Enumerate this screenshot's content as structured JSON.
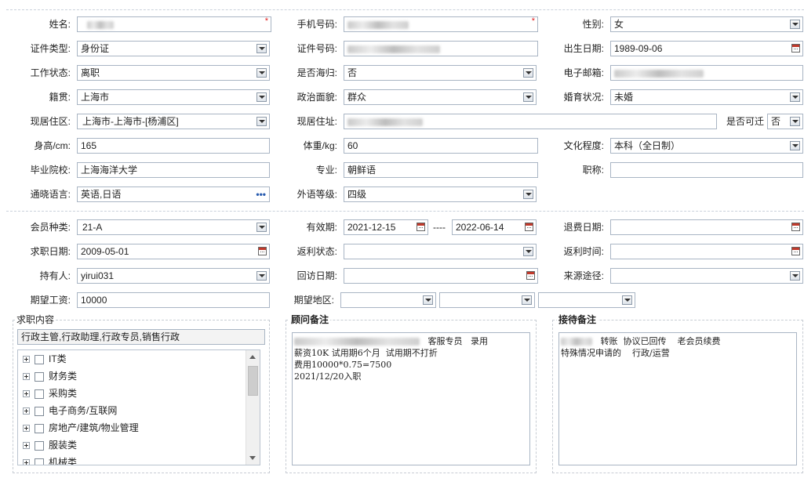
{
  "basic": {
    "name_label": "姓名:",
    "phone_label": "手机号码:",
    "required_mark": "*",
    "gender_label": "性别:",
    "gender_value": "女",
    "idtype_label": "证件类型:",
    "idtype_value": "身份证",
    "idno_label": "证件号码:",
    "birth_label": "出生日期:",
    "birth_value": "1989-09-06",
    "workstatus_label": "工作状态:",
    "workstatus_value": "离职",
    "returnee_label": "是否海归:",
    "returnee_value": "否",
    "email_label": "电子邮箱:",
    "native_label": "籍贯:",
    "native_value": "上海市",
    "political_label": "政治面貌:",
    "political_value": "群众",
    "marital_label": "婚育状况:",
    "marital_value": "未婚",
    "residence_label": "现居住区:",
    "residence_value": "上海市-上海市-[杨浦区]",
    "address_label": "现居住址:",
    "relocate_label": "是否可迁",
    "relocate_value": "否",
    "height_label": "身高/cm:",
    "height_value": "165",
    "weight_label": "体重/kg:",
    "weight_value": "60",
    "education_label": "文化程度:",
    "education_value": "本科（全日制）",
    "school_label": "毕业院校:",
    "school_value": "上海海洋大学",
    "major_label": "专业:",
    "major_value": "朝鲜语",
    "title_label": "职称:",
    "languages_label": "通晓语言:",
    "languages_value": "英语,日语",
    "languages_more": "•••",
    "foreignlevel_label": "外语等级:",
    "foreignlevel_value": "四级"
  },
  "membership": {
    "type_label": "会员种类:",
    "type_value": "21-A",
    "validity_label": "有效期:",
    "validity_start": "2021-12-15",
    "validity_sep": "----",
    "validity_end": "2022-06-14",
    "refund_date_label": "退费日期:",
    "jobseek_date_label": "求职日期:",
    "jobseek_date_value": "2009-05-01",
    "rebate_status_label": "返利状态:",
    "rebate_time_label": "返利时间:",
    "holder_label": "持有人:",
    "holder_value": "yirui031",
    "revisit_label": "回访日期:",
    "source_label": "来源途径:",
    "salary_label": "期望工资:",
    "salary_value": "10000",
    "region_label": "期望地区:"
  },
  "job_content": {
    "legend": "求职内容",
    "selected": "行政主管,行政助理,行政专员,销售行政",
    "categories": [
      "IT类",
      "财务类",
      "采购类",
      "电子商务/互联网",
      "房地产/建筑/物业管理",
      "服装类",
      "机械类"
    ]
  },
  "advisor_notes": {
    "legend": "顾问备注",
    "line1_suffix": "   客服专员   录用",
    "line2": "薪资10K 试用期6个月  试用期不打折",
    "line3": "费用10000*0.75=7500",
    "line4": "2021/12/20入职"
  },
  "reception_notes": {
    "legend": "接待备注",
    "line1_suffix": "   转账  协议已回传    老会员续费",
    "line2": "特殊情况申请的    行政/运营"
  }
}
